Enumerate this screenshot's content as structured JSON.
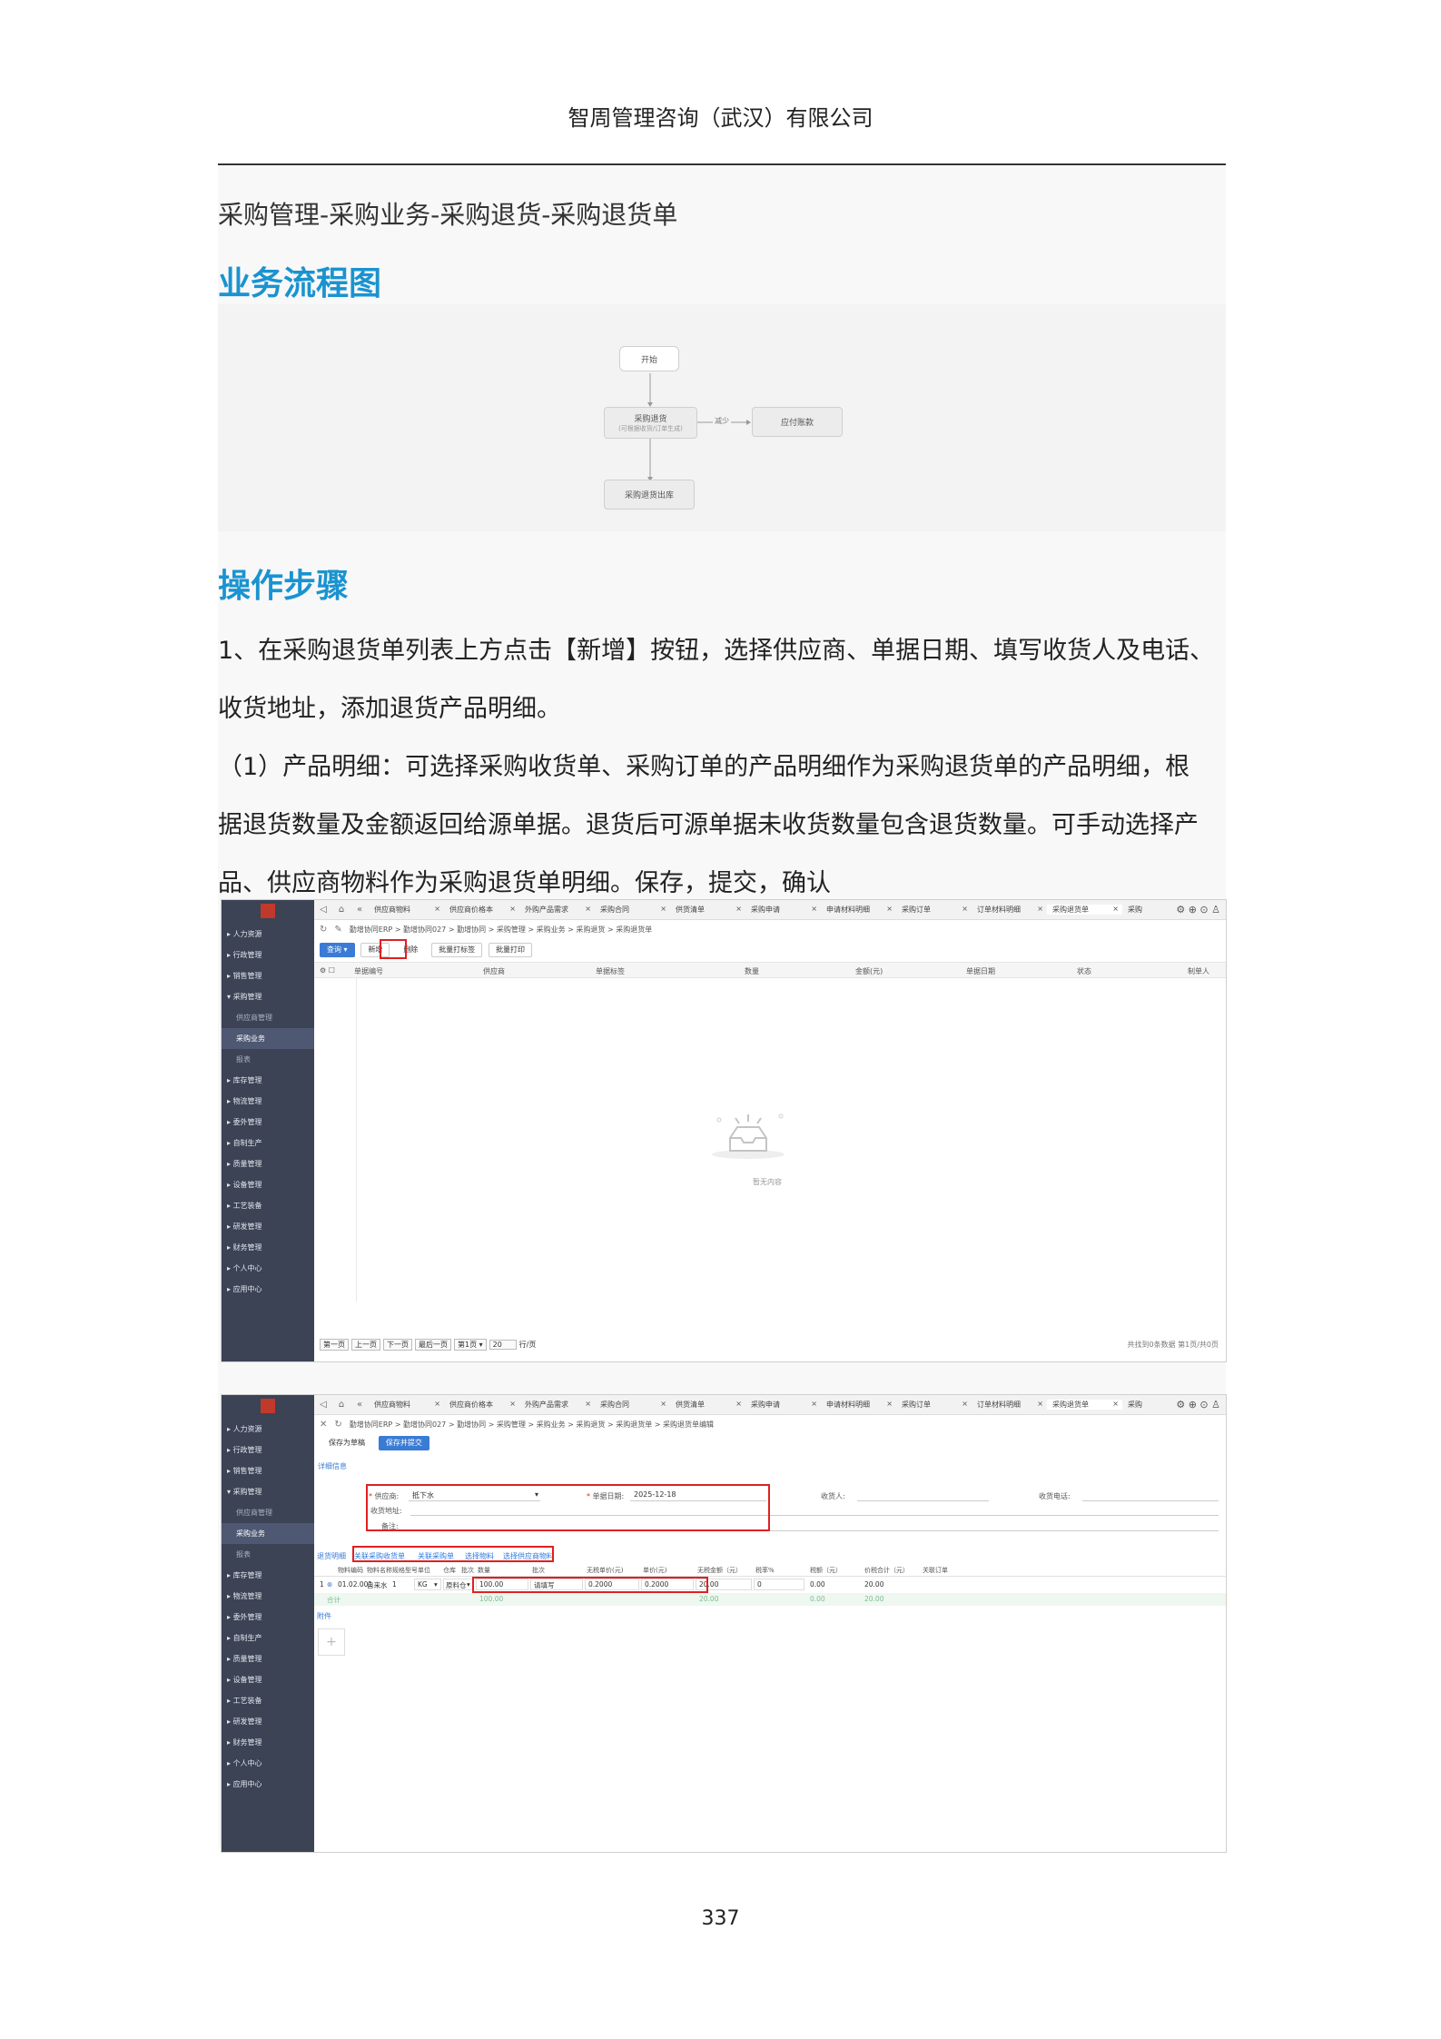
{
  "header": {
    "company": "智周管理咨询（武汉）有限公司"
  },
  "breadcrumb": "采购管理-采购业务-采购退货-采购退货单",
  "sections": {
    "flow_title": "业务流程图",
    "steps_title": "操作步骤"
  },
  "flow": {
    "start": "开始",
    "return": "采购退货",
    "return_sub": "(可根据收货/订单生成)",
    "decrease": "减少",
    "payable": "应付账款",
    "outbound": "采购退货出库"
  },
  "steps": {
    "line1": "1、在采购退货单列表上方点击【新增】按钮，选择供应商、单据日期、填写收货人及电话、",
    "line2": "收货地址，添加退货产品明细。",
    "line3": "（1）产品明细：可选择采购收货单、采购订单的产品明细作为采购退货单的产品明细，根",
    "line4": "据退货数量及金额返回给源单据。退货后可源单据未收货数量包含退货数量。可手动选择产",
    "line5": "品、供应商物料作为采购退货单明细。保存，提交，确认"
  },
  "sidebar": {
    "items": [
      "人力资源",
      "行政管理",
      "销售管理",
      "采购管理",
      "供应商管理",
      "采购业务",
      "报表",
      "库存管理",
      "物流管理",
      "委外管理",
      "自制生产",
      "质量管理",
      "设备管理",
      "工艺装备",
      "研发管理",
      "财务管理",
      "个人中心",
      "应用中心"
    ]
  },
  "tabs": [
    "供应商物料",
    "供应商价格本",
    "外购产品需求",
    "采购合同",
    "供货清单",
    "采购申请",
    "申请材料明细",
    "采购订单",
    "订单材料明细",
    "采购退货单",
    "采购"
  ],
  "shot1": {
    "crumb": "勤增协同ERP > 勤增协同027 > 勤增协同 > 采购管理 > 采购业务 > 采购退货 > 采购退货单",
    "buttons": {
      "query": "查询",
      "add": "新增",
      "delete": "删除",
      "batch_label": "批量打标签",
      "batch_print": "批量打印"
    },
    "columns": [
      "单据编号",
      "供应商",
      "单据标签",
      "数量",
      "金额(元)",
      "单据日期",
      "状态",
      "制单人"
    ],
    "empty": "暂无内容",
    "pager": {
      "first": "第一页",
      "prev": "上一页",
      "next": "下一页",
      "last": "最后一页",
      "page_select": "第1页",
      "page_size": "20",
      "per": "行/页",
      "summary": "共找到0条数据 第1页/共0页"
    }
  },
  "shot2": {
    "crumb": "勤增协同ERP > 勤增协同027 > 勤增协同 > 采购管理 > 采购业务 > 采购退货 > 采购退货单 > 采购退货单编辑",
    "buttons": {
      "save_draft": "保存为草稿",
      "save_submit": "保存并提交"
    },
    "detail_title": "详细信息",
    "form": {
      "supplier_label": "供应商:",
      "supplier_value": "抵下水",
      "date_label": "单据日期:",
      "date_value": "2025-12-18",
      "receiver_label": "收货人:",
      "phone_label": "收货电话:",
      "address_label": "收货地址:",
      "remark_label": "备注:"
    },
    "detail_links": {
      "title": "退货明细",
      "l1": "关联采购收货单",
      "l2": "关联采购单",
      "l3": "选择物料",
      "l4": "选择供应商物料"
    },
    "table_columns": [
      "物料编码",
      "物料名称",
      "规格型号",
      "单位",
      "仓库",
      "批次",
      "数量",
      "批次",
      "无税单价(元)",
      "单价(元)",
      "无税金额（元）",
      "税率%",
      "税额（元）",
      "价税合计（元）",
      "关联订单"
    ],
    "row": {
      "no": "1",
      "code": "01.02.001",
      "name": "自来水",
      "spec": "1",
      "unit": "KG",
      "warehouse": "原料仓",
      "qty": "100.00",
      "batch": "请填写",
      "price_notax": "0.2000",
      "price": "0.2000",
      "amount_notax": "20.00",
      "tax_rate": "0",
      "tax": "0.00",
      "total": "20.00"
    },
    "sum": {
      "label": "合计",
      "qty": "100.00",
      "amount_notax": "20.00",
      "tax": "0.00",
      "total": "20.00"
    },
    "attachment": "附件",
    "add_glyph": "+"
  },
  "page_number": "337"
}
